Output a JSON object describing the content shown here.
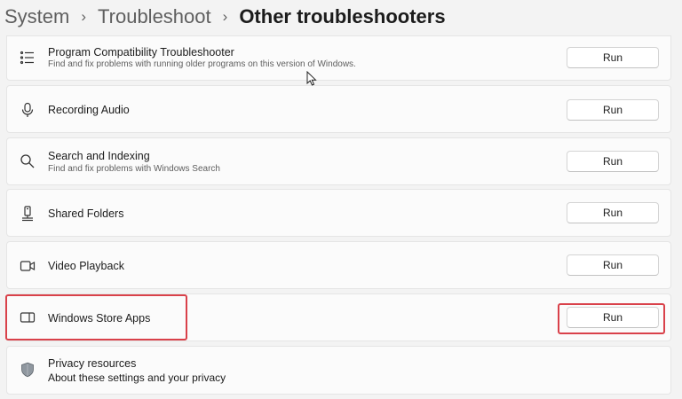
{
  "breadcrumb": {
    "items": [
      "System",
      "Troubleshoot"
    ],
    "separator": "›",
    "current": "Other troubleshooters"
  },
  "troubleshooters": [
    {
      "title": "Program Compatibility Troubleshooter",
      "subtitle": "Find and fix problems with running older programs on this version of Windows.",
      "button": "Run",
      "icon": "list-icon"
    },
    {
      "title": "Recording Audio",
      "button": "Run",
      "icon": "microphone-icon"
    },
    {
      "title": "Search and Indexing",
      "subtitle": "Find and fix problems with Windows Search",
      "button": "Run",
      "icon": "search-icon"
    },
    {
      "title": "Shared Folders",
      "button": "Run",
      "icon": "shared-folder-icon"
    },
    {
      "title": "Video Playback",
      "button": "Run",
      "icon": "video-camera-icon"
    },
    {
      "title": "Windows Store Apps",
      "button": "Run",
      "icon": "store-apps-icon"
    }
  ],
  "privacy": {
    "title": "Privacy resources",
    "link": "About these settings and your privacy",
    "icon": "shield-icon"
  },
  "highlight_color": "#d9414a"
}
